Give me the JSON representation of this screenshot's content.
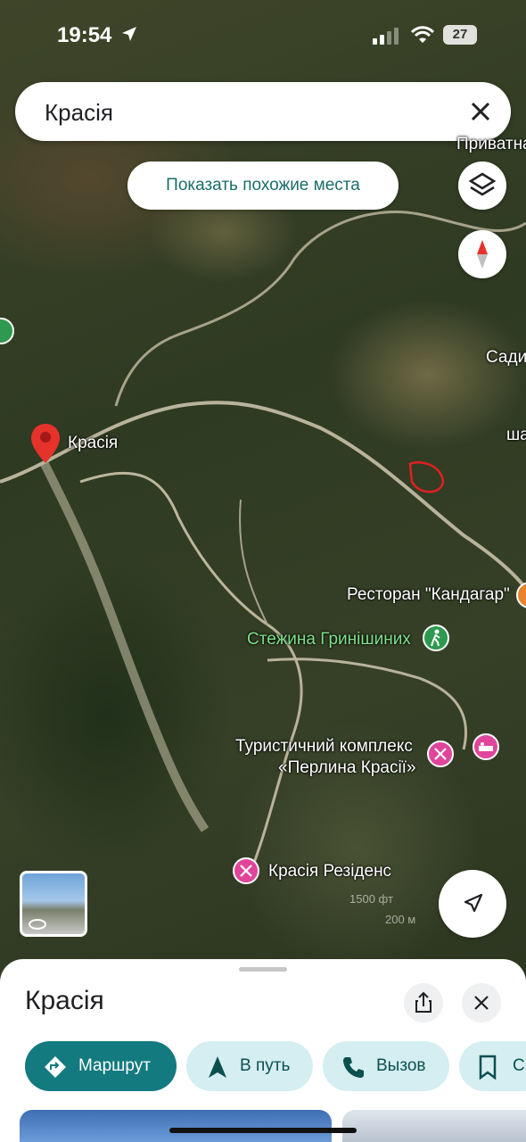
{
  "status_bar": {
    "time": "19:54",
    "battery": "27"
  },
  "search": {
    "query": "Красія"
  },
  "similar_button": {
    "label": "Показать похожие места"
  },
  "map": {
    "labels": {
      "krasia": "Красія",
      "restaurant": "Ресторан \"Кандагар\"",
      "trail": "Стежина Гринішиних",
      "tourist_complex_line1": "Туристичний комплекс",
      "tourist_complex_line2": "«Перлина Красії»",
      "residence": "Красія Резіденс",
      "edge_privatna": "Приватна",
      "edge_sady": "Сади",
      "edge_sha": "ша"
    },
    "scale": {
      "feet": "1500 фт",
      "meters": "200 м"
    }
  },
  "sheet": {
    "title": "Красія",
    "actions": [
      {
        "label": "Маршрут"
      },
      {
        "label": "В путь"
      },
      {
        "label": "Вызов"
      },
      {
        "label": "С"
      }
    ]
  },
  "colors": {
    "accent": "#137a7f",
    "chip_bg": "#d4eef1",
    "poi": "#e0459b",
    "pin": "#e5322b"
  }
}
